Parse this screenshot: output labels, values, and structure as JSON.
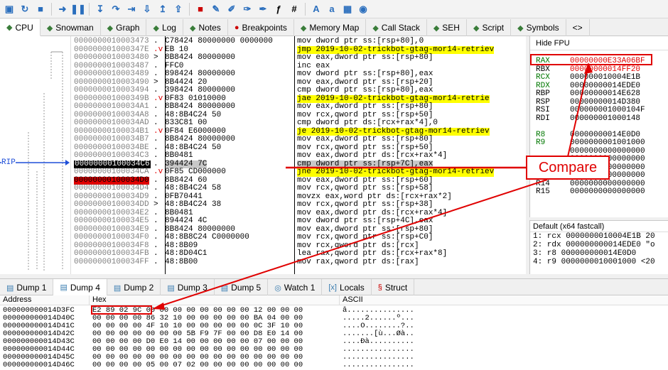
{
  "toolbar": {
    "icons": [
      "open-icon",
      "restart-icon",
      "stop-icon",
      "run-icon",
      "pause-icon",
      "step-into-icon",
      "step-over-icon",
      "trace-into-icon",
      "trace-over-icon",
      "execute-till-return-icon",
      "run-to-user-icon",
      "breakpoint-icon",
      "patch-icon",
      "comment-icon",
      "label-icon",
      "bookmark-icon",
      "function-icon",
      "hash-icon",
      "font-icon",
      "case-icon",
      "calc-icon",
      "globe-icon"
    ],
    "fx": "fx",
    "hash": "#",
    "az": "Aa"
  },
  "tabs": [
    {
      "label": "CPU",
      "icon": "cpu-icon",
      "active": true
    },
    {
      "label": "Snowman",
      "icon": "snowman-icon"
    },
    {
      "label": "Graph",
      "icon": "graph-icon"
    },
    {
      "label": "Log",
      "icon": "log-icon"
    },
    {
      "label": "Notes",
      "icon": "notes-icon"
    },
    {
      "label": "Breakpoints",
      "icon": "breakpoint-dot-icon"
    },
    {
      "label": "Memory Map",
      "icon": "memory-map-icon"
    },
    {
      "label": "Call Stack",
      "icon": "call-stack-icon"
    },
    {
      "label": "SEH",
      "icon": "seh-icon"
    },
    {
      "label": "Script",
      "icon": "script-icon"
    },
    {
      "label": "Symbols",
      "icon": "symbols-icon"
    }
  ],
  "rip_label": "RIP",
  "disasm": [
    {
      "addr": "0000000010003473",
      "m": ".",
      "bytes": "C78424 80000000 0000000",
      "instr": "mov dword ptr ss:[rsp+80],0"
    },
    {
      "addr": "000000001000347E",
      "m": ".v",
      "bytes": "EB 10",
      "instr": "jmp 2019-10-02-trickbot-gtag-mor14-retriev",
      "hl": true
    },
    {
      "addr": "0000000010003480",
      "m": ">",
      "bytes": "8B8424 80000000",
      "instr": "mov eax,dword ptr ss:[rsp+80]"
    },
    {
      "addr": "0000000010003487",
      "m": ".",
      "bytes": "FFC0",
      "instr": "inc eax"
    },
    {
      "addr": "0000000010003489",
      "m": ".",
      "bytes": "898424 80000000",
      "instr": "mov dword ptr ss:[rsp+80],eax"
    },
    {
      "addr": "0000000010003490",
      "m": ">",
      "bytes": "8B4424 20",
      "instr": "mov eax,dword ptr ss:[rsp+20]"
    },
    {
      "addr": "0000000010003494",
      "m": ".",
      "bytes": "398424 80000000",
      "instr": "cmp dword ptr ss:[rsp+80],eax"
    },
    {
      "addr": "000000001000349B",
      "m": ".v",
      "bytes": "0F83 01010000",
      "instr": "jae 2019-10-02-trickbot-gtag-mor14-retrie",
      "hl": true
    },
    {
      "addr": "00000000100034A1",
      "m": ".",
      "bytes": "8B8424 80000000",
      "instr": "mov eax,dword ptr ss:[rsp+80]"
    },
    {
      "addr": "00000000100034A8",
      "m": ".",
      "bytes": "48:8B4C24 50",
      "instr": "mov rcx,qword ptr ss:[rsp+50]"
    },
    {
      "addr": "00000000100034AD",
      "m": ".",
      "bytes": "833C81 00",
      "instr": "cmp dword ptr ds:[rcx+rax*4],0"
    },
    {
      "addr": "00000000100034B1",
      "m": ".v",
      "bytes": "0F84 E6000000",
      "instr": "je 2019-10-02-trickbot-gtag-mor14-retriev",
      "hl": true
    },
    {
      "addr": "00000000100034B7",
      "m": ".",
      "bytes": "8B8424 80000000",
      "instr": "mov eax,dword ptr ss:[rsp+80]"
    },
    {
      "addr": "00000000100034BE",
      "m": ".",
      "bytes": "48:8B4C24 50",
      "instr": "mov rcx,qword ptr ss:[rsp+50]"
    },
    {
      "addr": "00000000100034C3",
      "m": ".",
      "bytes": "8B0481",
      "instr": "mov eax,dword ptr ds:[rcx+rax*4]"
    },
    {
      "addr": "00000000100034C6",
      "m": ".",
      "bytes": "394424 7C",
      "instr": "cmp dword ptr ss:[rsp+7C],eax",
      "cur": true
    },
    {
      "addr": "00000000100034CA",
      "m": ".v",
      "bytes": "0F85 CD000000",
      "instr": "jne 2019-10-02-trickbot-gtag-mor14-retriev",
      "hl": true
    },
    {
      "addr": "00000000100034D0",
      "m": ".",
      "bytes": "8B8424 60",
      "instr": "mov eax,dword ptr ss:[rsp+60]",
      "bp": true
    },
    {
      "addr": "00000000100034D4",
      "m": ".",
      "bytes": "48:8B4C24 58",
      "instr": "mov rcx,qword ptr ss:[rsp+58]"
    },
    {
      "addr": "00000000100034D9",
      "m": ".",
      "bytes": "0FB70441",
      "instr": "movzx eax,word ptr ds:[rcx+rax*2]"
    },
    {
      "addr": "00000000100034DD",
      "m": ">",
      "bytes": "48:8B4C24 38",
      "instr": "mov rcx,qword ptr ss:[rsp+38]"
    },
    {
      "addr": "00000000100034E2",
      "m": ".",
      "bytes": "8B0481",
      "instr": "mov eax,dword ptr ds:[rcx+rax*4]"
    },
    {
      "addr": "00000000100034E5",
      "m": ".",
      "bytes": "894424 4C",
      "instr": "mov dword ptr ss:[rsp+4C],eax"
    },
    {
      "addr": "00000000100034E9",
      "m": ".",
      "bytes": "8B8424 80000000",
      "instr": "mov eax,dword ptr ss:[rsp+80]"
    },
    {
      "addr": "00000000100034F0",
      "m": ".",
      "bytes": "48:8B8C24 C0000000",
      "instr": "mov rcx,qword ptr ss:[rsp+C0]"
    },
    {
      "addr": "00000000100034F8",
      "m": ".",
      "bytes": "48:8B09",
      "instr": "mov rcx,qword ptr ds:[rcx]"
    },
    {
      "addr": "00000000100034FB",
      "m": ".",
      "bytes": "48:8D04C1",
      "instr": "lea rax,qword ptr ds:[rcx+rax*8]"
    },
    {
      "addr": "00000000100034FF",
      "m": ".",
      "bytes": "48:8B00",
      "instr": "mov rax,qword ptr ds:[rax]"
    }
  ],
  "regs": {
    "header": "Hide FPU",
    "list": [
      {
        "n": "RAX",
        "v": "00000000E33A06BF"
      },
      {
        "n": "RBX",
        "v": "00000000014FF20"
      },
      {
        "n": "RCX",
        "v": "000000010004E1B"
      },
      {
        "n": "RDX",
        "v": "00000000014EDE0"
      },
      {
        "n": "RBP",
        "v": "00000000014E628"
      },
      {
        "n": "RSP",
        "v": "00000000014D380"
      },
      {
        "n": "RSI",
        "v": "000000001000104F"
      },
      {
        "n": "RDI",
        "v": "000000001000148"
      },
      {
        "n": "",
        "v": ""
      },
      {
        "n": "R8",
        "v": "00000000014E0D0"
      },
      {
        "n": "R9",
        "v": "0000000001001000"
      },
      {
        "n": "",
        "v": "0000000000000000"
      },
      {
        "n": "",
        "v": "0000000000000000"
      },
      {
        "n": "",
        "v": "0000000000000000"
      },
      {
        "n": "R13",
        "v": "0000000000000000"
      },
      {
        "n": "R14",
        "v": "0000000000000000"
      },
      {
        "n": "R15",
        "v": "0000000000000000"
      }
    ]
  },
  "callconv": {
    "header": "Default (x64 fastcall)",
    "rows": [
      "1: rcx 0000000010004E1B 20",
      "2: rdx 000000000014EDE0 \"o",
      "3: r8 000000000014E0D0",
      "4: r9 0000000010001000 <20"
    ]
  },
  "bottom_tabs": [
    {
      "label": "Dump 1",
      "icon": "dump-icon"
    },
    {
      "label": "Dump 4",
      "icon": "dump-icon",
      "active": true
    },
    {
      "label": "Dump 2",
      "icon": "dump-icon"
    },
    {
      "label": "Dump 3",
      "icon": "dump-icon"
    },
    {
      "label": "Dump 5",
      "icon": "dump-icon"
    },
    {
      "label": "Watch 1",
      "icon": "watch-icon"
    },
    {
      "label": "Locals",
      "icon": "locals-icon"
    },
    {
      "label": "Struct",
      "icon": "struct-icon"
    }
  ],
  "dump": {
    "headers": {
      "address": "Address",
      "hex": "Hex",
      "ascii": "ASCII"
    },
    "rows": [
      {
        "a": "000000000014D3FC",
        "h": "E2 89 02 9C 00 00 00 00 00 00 00 00 12 00 00 00",
        "s": "â..............."
      },
      {
        "a": "000000000014D40C",
        "h": "00 00 00 00 86 32 10 00 00 00 00 00 BA 04 00 00",
        "s": ".....2......º..."
      },
      {
        "a": "000000000014D41C",
        "h": "00 00 00 00 4F 10 10 00 00 00 00 00 0C 3F 10 00",
        "s": "....O........?.."
      },
      {
        "a": "000000000014D42C",
        "h": "00 00 00 00 00 00 00 5B F9 7F 00 00 D8 E0 14 00",
        "s": ".......[ù...Øà.."
      },
      {
        "a": "000000000014D43C",
        "h": "00 00 00 00 D0 E0 14 00 00 00 00 00 07 00 00 00",
        "s": "....Ðà.........."
      },
      {
        "a": "000000000014D44C",
        "h": "00 00 00 00 00 00 00 00 00 00 00 00 00 00 00 00",
        "s": "................"
      },
      {
        "a": "000000000014D45C",
        "h": "00 00 00 00 00 00 00 00 00 00 00 00 00 00 00 00",
        "s": "................"
      },
      {
        "a": "000000000014D46C",
        "h": "00 00 00 00 05 00 07 02 00 00 00 00 00 00 00 00",
        "s": "................"
      }
    ]
  },
  "annotation": {
    "label": "Compare",
    "color": "#e00000"
  }
}
